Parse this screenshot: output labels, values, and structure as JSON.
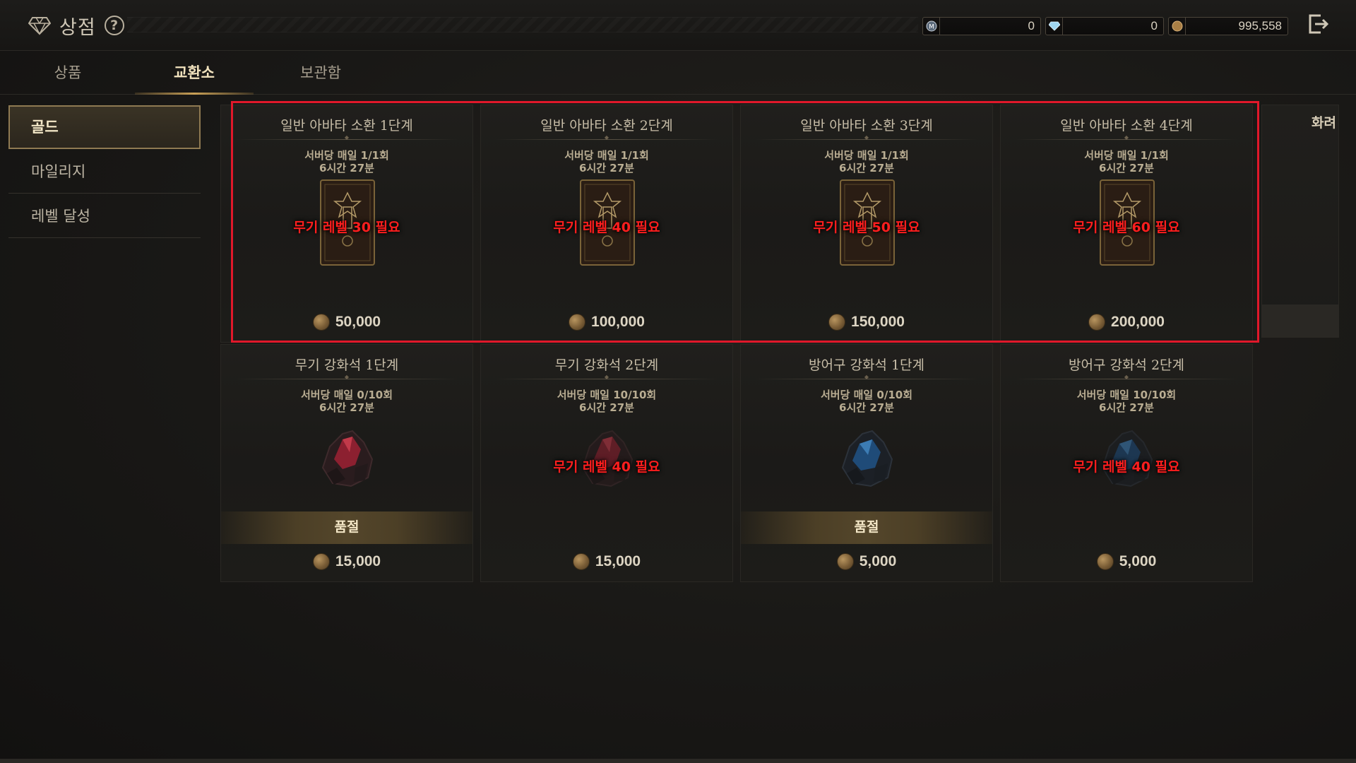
{
  "header": {
    "title": "상점",
    "help_icon": "question-circle-icon",
    "exit_icon": "exit-icon",
    "currencies": [
      {
        "icon": "mileage-coin-icon",
        "value": "0"
      },
      {
        "icon": "diamond-icon",
        "value": "0"
      },
      {
        "icon": "gold-coin-icon",
        "value": "995,558"
      }
    ]
  },
  "tabs": [
    {
      "label": "상품",
      "active": false
    },
    {
      "label": "교환소",
      "active": true
    },
    {
      "label": "보관함",
      "active": false
    }
  ],
  "sidebar": {
    "items": [
      {
        "label": "골드",
        "active": true
      },
      {
        "label": "마일리지",
        "active": false
      },
      {
        "label": "레벨 달성",
        "active": false
      }
    ]
  },
  "cards": [
    {
      "title": "일반 아바타 소환 1단계",
      "limit": "서버당 매일 1/1회",
      "timer": "6시간 27분",
      "warning": "무기 레벨 30 필요",
      "soldout": "",
      "price": "50,000",
      "image": "avatar-summon-card-icon"
    },
    {
      "title": "일반 아바타 소환 2단계",
      "limit": "서버당 매일 1/1회",
      "timer": "6시간 27분",
      "warning": "무기 레벨 40 필요",
      "soldout": "",
      "price": "100,000",
      "image": "avatar-summon-card-icon"
    },
    {
      "title": "일반 아바타 소환 3단계",
      "limit": "서버당 매일 1/1회",
      "timer": "6시간 27분",
      "warning": "무기 레벨 50 필요",
      "soldout": "",
      "price": "150,000",
      "image": "avatar-summon-card-icon"
    },
    {
      "title": "일반 아바타 소환 4단계",
      "limit": "서버당 매일 1/1회",
      "timer": "6시간 27분",
      "warning": "무기 레벨 60 필요",
      "soldout": "",
      "price": "200,000",
      "image": "avatar-summon-card-icon"
    },
    {
      "title": "무기 강화석 1단계",
      "limit": "서버당 매일 0/10회",
      "timer": "6시간 27분",
      "warning": "",
      "soldout": "품절",
      "price": "15,000",
      "image": "red-enhance-stone-icon"
    },
    {
      "title": "무기 강화석 2단계",
      "limit": "서버당 매일 10/10회",
      "timer": "6시간 27분",
      "warning": "무기 레벨 40 필요",
      "soldout": "",
      "price": "15,000",
      "image": "red-enhance-stone-icon"
    },
    {
      "title": "방어구 강화석 1단계",
      "limit": "서버당 매일 0/10회",
      "timer": "6시간 27분",
      "warning": "",
      "soldout": "품절",
      "price": "5,000",
      "image": "blue-enhance-stone-icon"
    },
    {
      "title": "방어구 강화석 2단계",
      "limit": "서버당 매일 10/10회",
      "timer": "6시간 27분",
      "warning": "무기 레벨 40 필요",
      "soldout": "",
      "price": "5,000",
      "image": "blue-enhance-stone-icon"
    }
  ],
  "partial_card": {
    "title": "화려"
  },
  "colors": {
    "highlight": "#e0182a",
    "warning": "#ff1e1e",
    "gold_accent": "#c9a056"
  }
}
